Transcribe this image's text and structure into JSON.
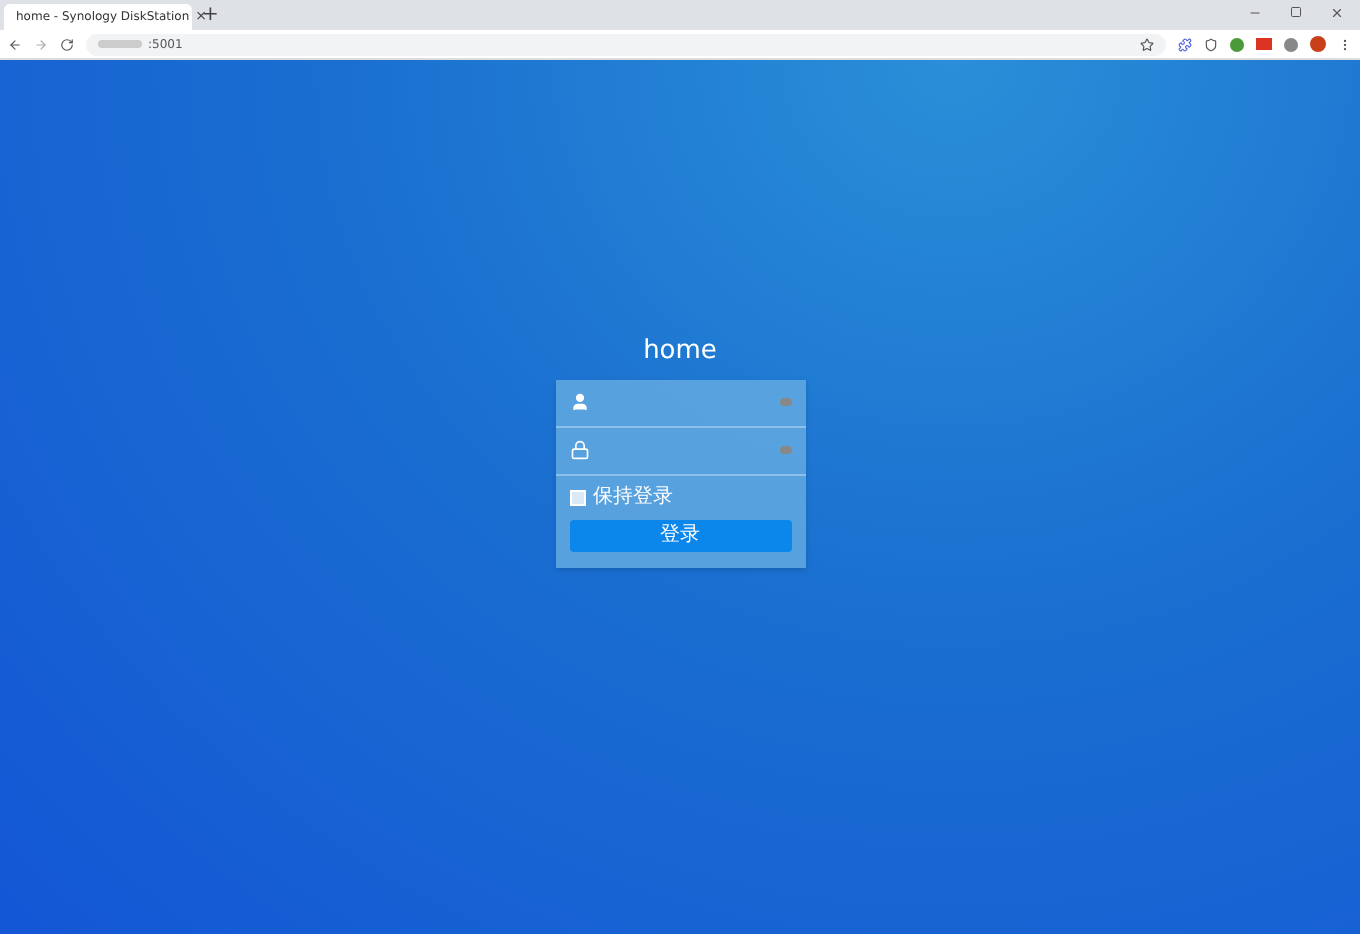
{
  "browser": {
    "tab": {
      "title": "home - Synology DiskStation",
      "close": "×"
    },
    "new_tab": "+",
    "address": ":5001"
  },
  "login": {
    "title": "home",
    "fields": [
      {
        "kind": "user"
      },
      {
        "kind": "password"
      }
    ],
    "remember": {
      "label": "保持登录",
      "checked": false
    },
    "submit": "登录"
  }
}
